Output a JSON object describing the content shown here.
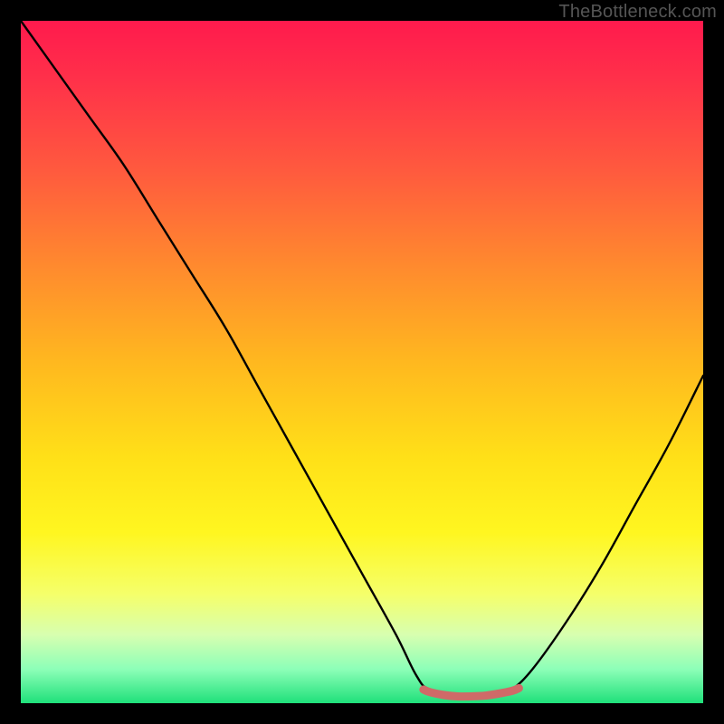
{
  "attribution": "TheBottleneck.com",
  "chart_data": {
    "type": "line",
    "title": "",
    "xlabel": "",
    "ylabel": "",
    "xlim": [
      0,
      100
    ],
    "ylim": [
      0,
      100
    ],
    "grid": false,
    "legend": false,
    "series": [
      {
        "name": "bottleneck-curve",
        "x": [
          0,
          5,
          10,
          15,
          20,
          25,
          30,
          35,
          40,
          45,
          50,
          55,
          58,
          60,
          65,
          70,
          72,
          75,
          80,
          85,
          90,
          95,
          100
        ],
        "values": [
          100,
          93,
          86,
          79,
          71,
          63,
          55,
          46,
          37,
          28,
          19,
          10,
          4,
          2,
          1,
          1,
          2,
          5,
          12,
          20,
          29,
          38,
          48
        ]
      },
      {
        "name": "optimal-band",
        "x": [
          59,
          60,
          62,
          64,
          66,
          68,
          70,
          72,
          73
        ],
        "values": [
          2.0,
          1.6,
          1.2,
          1.0,
          1.0,
          1.1,
          1.4,
          1.8,
          2.2
        ]
      }
    ],
    "colors": {
      "curve": "#000000",
      "band": "#cf6a68"
    }
  }
}
